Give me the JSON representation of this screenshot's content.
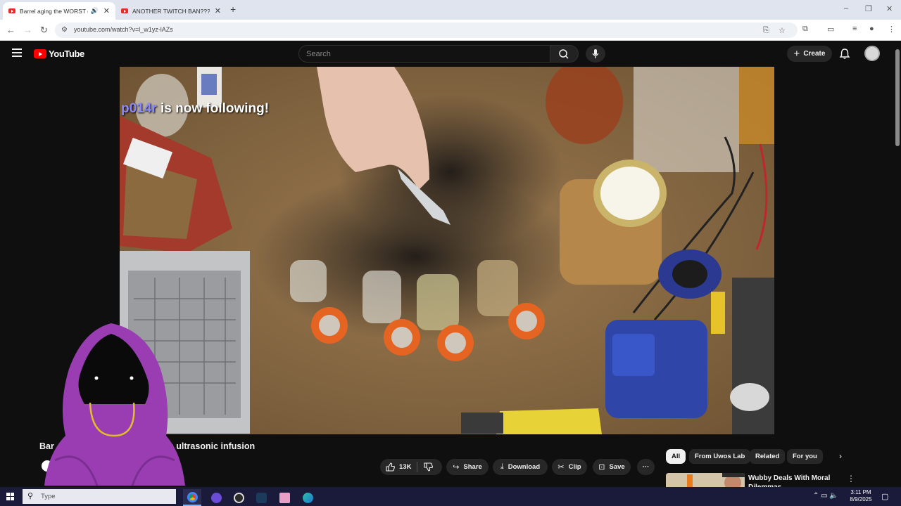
{
  "browser": {
    "tabs": [
      {
        "title": "Barrel aging the WORST dr",
        "active": true,
        "audio": true
      },
      {
        "title": "ANOTHER TWITCH BAN??? - Yo",
        "active": false,
        "audio": false
      }
    ],
    "new_tab": "+",
    "window_controls": {
      "minimize": "–",
      "restore": "❐",
      "close": "✕"
    },
    "url": "youtube.com/watch?v=l_w1yz-lAZs"
  },
  "youtube": {
    "logo_text": "YouTube",
    "search_placeholder": "Search",
    "create_label": "Create",
    "create_icon": "+"
  },
  "video": {
    "overlay": {
      "username": "p014r",
      "message": " is now following!"
    },
    "title_start": "Bar",
    "title_end": "with ultrasonic infusion"
  },
  "actions": {
    "likes": "13K",
    "share": "Share",
    "download": "Download",
    "clip": "Clip",
    "save": "Save",
    "more": "···"
  },
  "recommendations": {
    "chips": [
      "All",
      "From Uwos Lab",
      "Related",
      "For you"
    ],
    "selected_chip": "All",
    "first_title": "Wubby Deals With Moral Dilemmas"
  },
  "taskbar": {
    "search_placeholder": "Type",
    "time": "3:11 PM",
    "date": "8/9/2025"
  },
  "colors": {
    "yt_red": "#ff0000",
    "yt_bg": "#0f0f0f",
    "follower_name": "#8b8bff",
    "hood_purple": "#9a3db3"
  },
  "icons": {
    "search": "search-icon",
    "mic": "mic-icon",
    "bell": "bell-icon",
    "like": "thumbs-up-icon",
    "dislike": "thumbs-down-icon"
  }
}
